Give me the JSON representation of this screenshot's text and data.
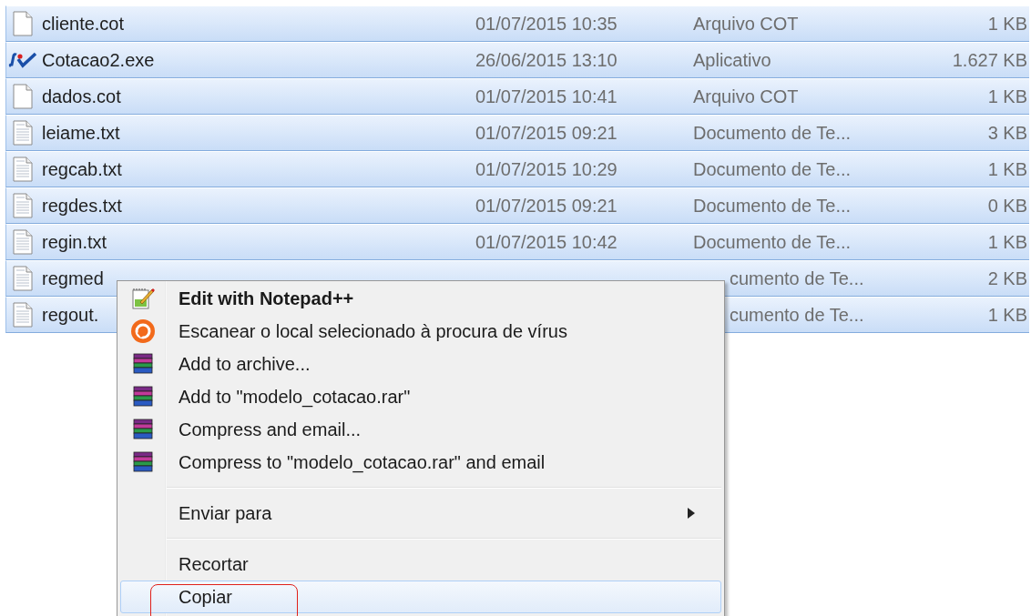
{
  "files": [
    {
      "name": "cliente.cot",
      "date": "01/07/2015 10:35",
      "type": "Arquivo COT",
      "size": "1 KB",
      "kind": "blank",
      "selected": true,
      "under_menu": false
    },
    {
      "name": "Cotacao2.exe",
      "date": "26/06/2015 13:10",
      "type": "Aplicativo",
      "size": "1.627 KB",
      "kind": "exe",
      "selected": true,
      "under_menu": false
    },
    {
      "name": "dados.cot",
      "date": "01/07/2015 10:41",
      "type": "Arquivo COT",
      "size": "1 KB",
      "kind": "blank",
      "selected": true,
      "under_menu": false
    },
    {
      "name": "leiame.txt",
      "date": "01/07/2015 09:21",
      "type": "Documento de Te...",
      "size": "3 KB",
      "kind": "text",
      "selected": true,
      "under_menu": false
    },
    {
      "name": "regcab.txt",
      "date": "01/07/2015 10:29",
      "type": "Documento de Te...",
      "size": "1 KB",
      "kind": "text",
      "selected": true,
      "under_menu": false
    },
    {
      "name": "regdes.txt",
      "date": "01/07/2015 09:21",
      "type": "Documento de Te...",
      "size": "0 KB",
      "kind": "text",
      "selected": true,
      "under_menu": false
    },
    {
      "name": "regin.txt",
      "date": "01/07/2015 10:42",
      "type": "Documento de Te...",
      "size": "1 KB",
      "kind": "text",
      "selected": true,
      "under_menu": false
    },
    {
      "name": "regmed",
      "type": "cumento de Te...",
      "size": "2 KB",
      "kind": "text",
      "selected": true,
      "under_menu": true
    },
    {
      "name": "regout.",
      "type": "cumento de Te...",
      "size": "1 KB",
      "kind": "text",
      "selected": true,
      "under_menu": true
    }
  ],
  "context_menu": {
    "items": [
      {
        "kind": "notepad",
        "label": "Edit with Notepad++",
        "bold": true,
        "submenu": false,
        "selected": false,
        "circled": false
      },
      {
        "kind": "scan",
        "label": "Escanear o local selecionado à procura de vírus",
        "bold": false,
        "submenu": false,
        "selected": false,
        "circled": false
      },
      {
        "kind": "archive",
        "label": "Add to archive...",
        "bold": false,
        "submenu": false,
        "selected": false,
        "circled": false
      },
      {
        "kind": "archive",
        "label": "Add to \"modelo_cotacao.rar\"",
        "bold": false,
        "submenu": false,
        "selected": false,
        "circled": false
      },
      {
        "kind": "archive",
        "label": "Compress and email...",
        "bold": false,
        "submenu": false,
        "selected": false,
        "circled": false
      },
      {
        "kind": "archive",
        "label": "Compress to \"modelo_cotacao.rar\" and email",
        "bold": false,
        "submenu": false,
        "selected": false,
        "circled": false
      },
      {
        "kind": "separator"
      },
      {
        "kind": "plain",
        "label": "Enviar para",
        "bold": false,
        "submenu": true,
        "selected": false,
        "circled": false
      },
      {
        "kind": "separator"
      },
      {
        "kind": "plain",
        "label": "Recortar",
        "bold": false,
        "submenu": false,
        "selected": false,
        "circled": false
      },
      {
        "kind": "plain",
        "label": "Copiar",
        "bold": false,
        "submenu": false,
        "selected": true,
        "circled": true
      }
    ]
  }
}
